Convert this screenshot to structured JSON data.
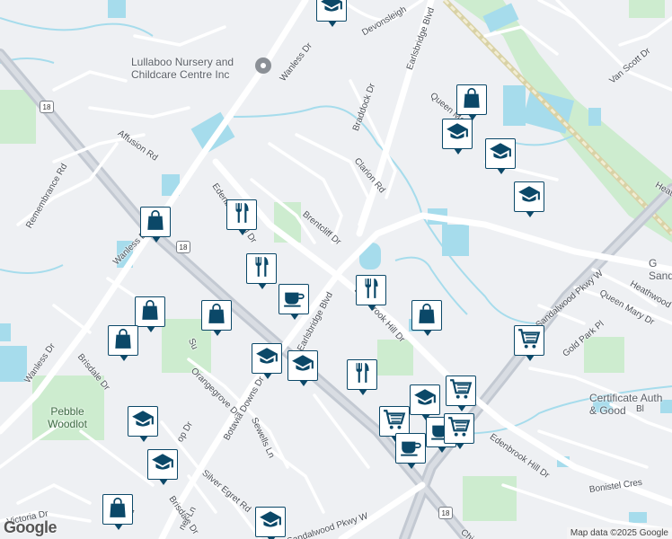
{
  "map": {
    "colors": {
      "land": "#eef0f3",
      "park": "#cdeccf",
      "water": "#a6dcec",
      "road": "#ffffff",
      "highway": "#c3c9d2",
      "rail": "#e6e2c8",
      "pin_fill": "#0b4868"
    },
    "streets": [
      "Wanless Dr",
      "Devonsleigh",
      "Earlsbridge Blvd",
      "Van Scott Dr",
      "Braddock Dr",
      "Queen Ma",
      "Affusion Rd",
      "Clarion Rd",
      "Edenbrook Hill Dr",
      "Remembrance Rd",
      "Brentcliff Dr",
      "Earlsbridge Blvd",
      "Edenbrook Hill Dr",
      "Wanless Dr",
      "Sandalwood Pkwy W",
      "Queen Mary Dr",
      "Heathwood",
      "Gold Park Pl",
      "Orangegrove Dr",
      "Botavia Downs Dr",
      "Sewells Ln",
      "Brisdale Dr",
      "Wanless Dr",
      "Edenbrook Hill Dr",
      "Silver Egret Rd",
      "Bonistel Cres",
      "Brisdale Dr",
      "Victoria Dr",
      "Sandalwood Pkwy W",
      "Chi",
      "Bl",
      "Heathw",
      "Blvd",
      "Su",
      "op Dr",
      "ner Ln"
    ],
    "places": {
      "nursery": "Lullaboo Nursery and Childcare Centre Inc",
      "certificate": "Certificate Auth & Good",
      "sandal": "G Sand"
    },
    "parks": {
      "pebble": "Pebble Woodlot"
    },
    "route_shields": [
      "18",
      "18",
      "18"
    ],
    "pins": [
      {
        "icon": "school-icon"
      },
      {
        "icon": "shopping-bag-icon"
      },
      {
        "icon": "school-icon"
      },
      {
        "icon": "school-icon"
      },
      {
        "icon": "school-icon"
      },
      {
        "icon": "restaurant-icon"
      },
      {
        "icon": "shopping-bag-icon"
      },
      {
        "icon": "restaurant-icon"
      },
      {
        "icon": "cafe-icon"
      },
      {
        "icon": "restaurant-icon"
      },
      {
        "icon": "shopping-bag-icon"
      },
      {
        "icon": "shopping-bag-icon"
      },
      {
        "icon": "shopping-bag-icon"
      },
      {
        "icon": "shopping-bag-icon"
      },
      {
        "icon": "school-icon"
      },
      {
        "icon": "school-icon"
      },
      {
        "icon": "restaurant-icon"
      },
      {
        "icon": "grocery-cart-icon"
      },
      {
        "icon": "grocery-cart-icon"
      },
      {
        "icon": "school-icon"
      },
      {
        "icon": "grocery-cart-icon"
      },
      {
        "icon": "cafe-icon"
      },
      {
        "icon": "grocery-cart-icon"
      },
      {
        "icon": "cafe-icon"
      },
      {
        "icon": "school-icon"
      },
      {
        "icon": "school-icon"
      },
      {
        "icon": "shopping-bag-icon"
      },
      {
        "icon": "school-icon"
      }
    ],
    "attribution": "Map data ©2025 Google",
    "logo": "Google"
  }
}
